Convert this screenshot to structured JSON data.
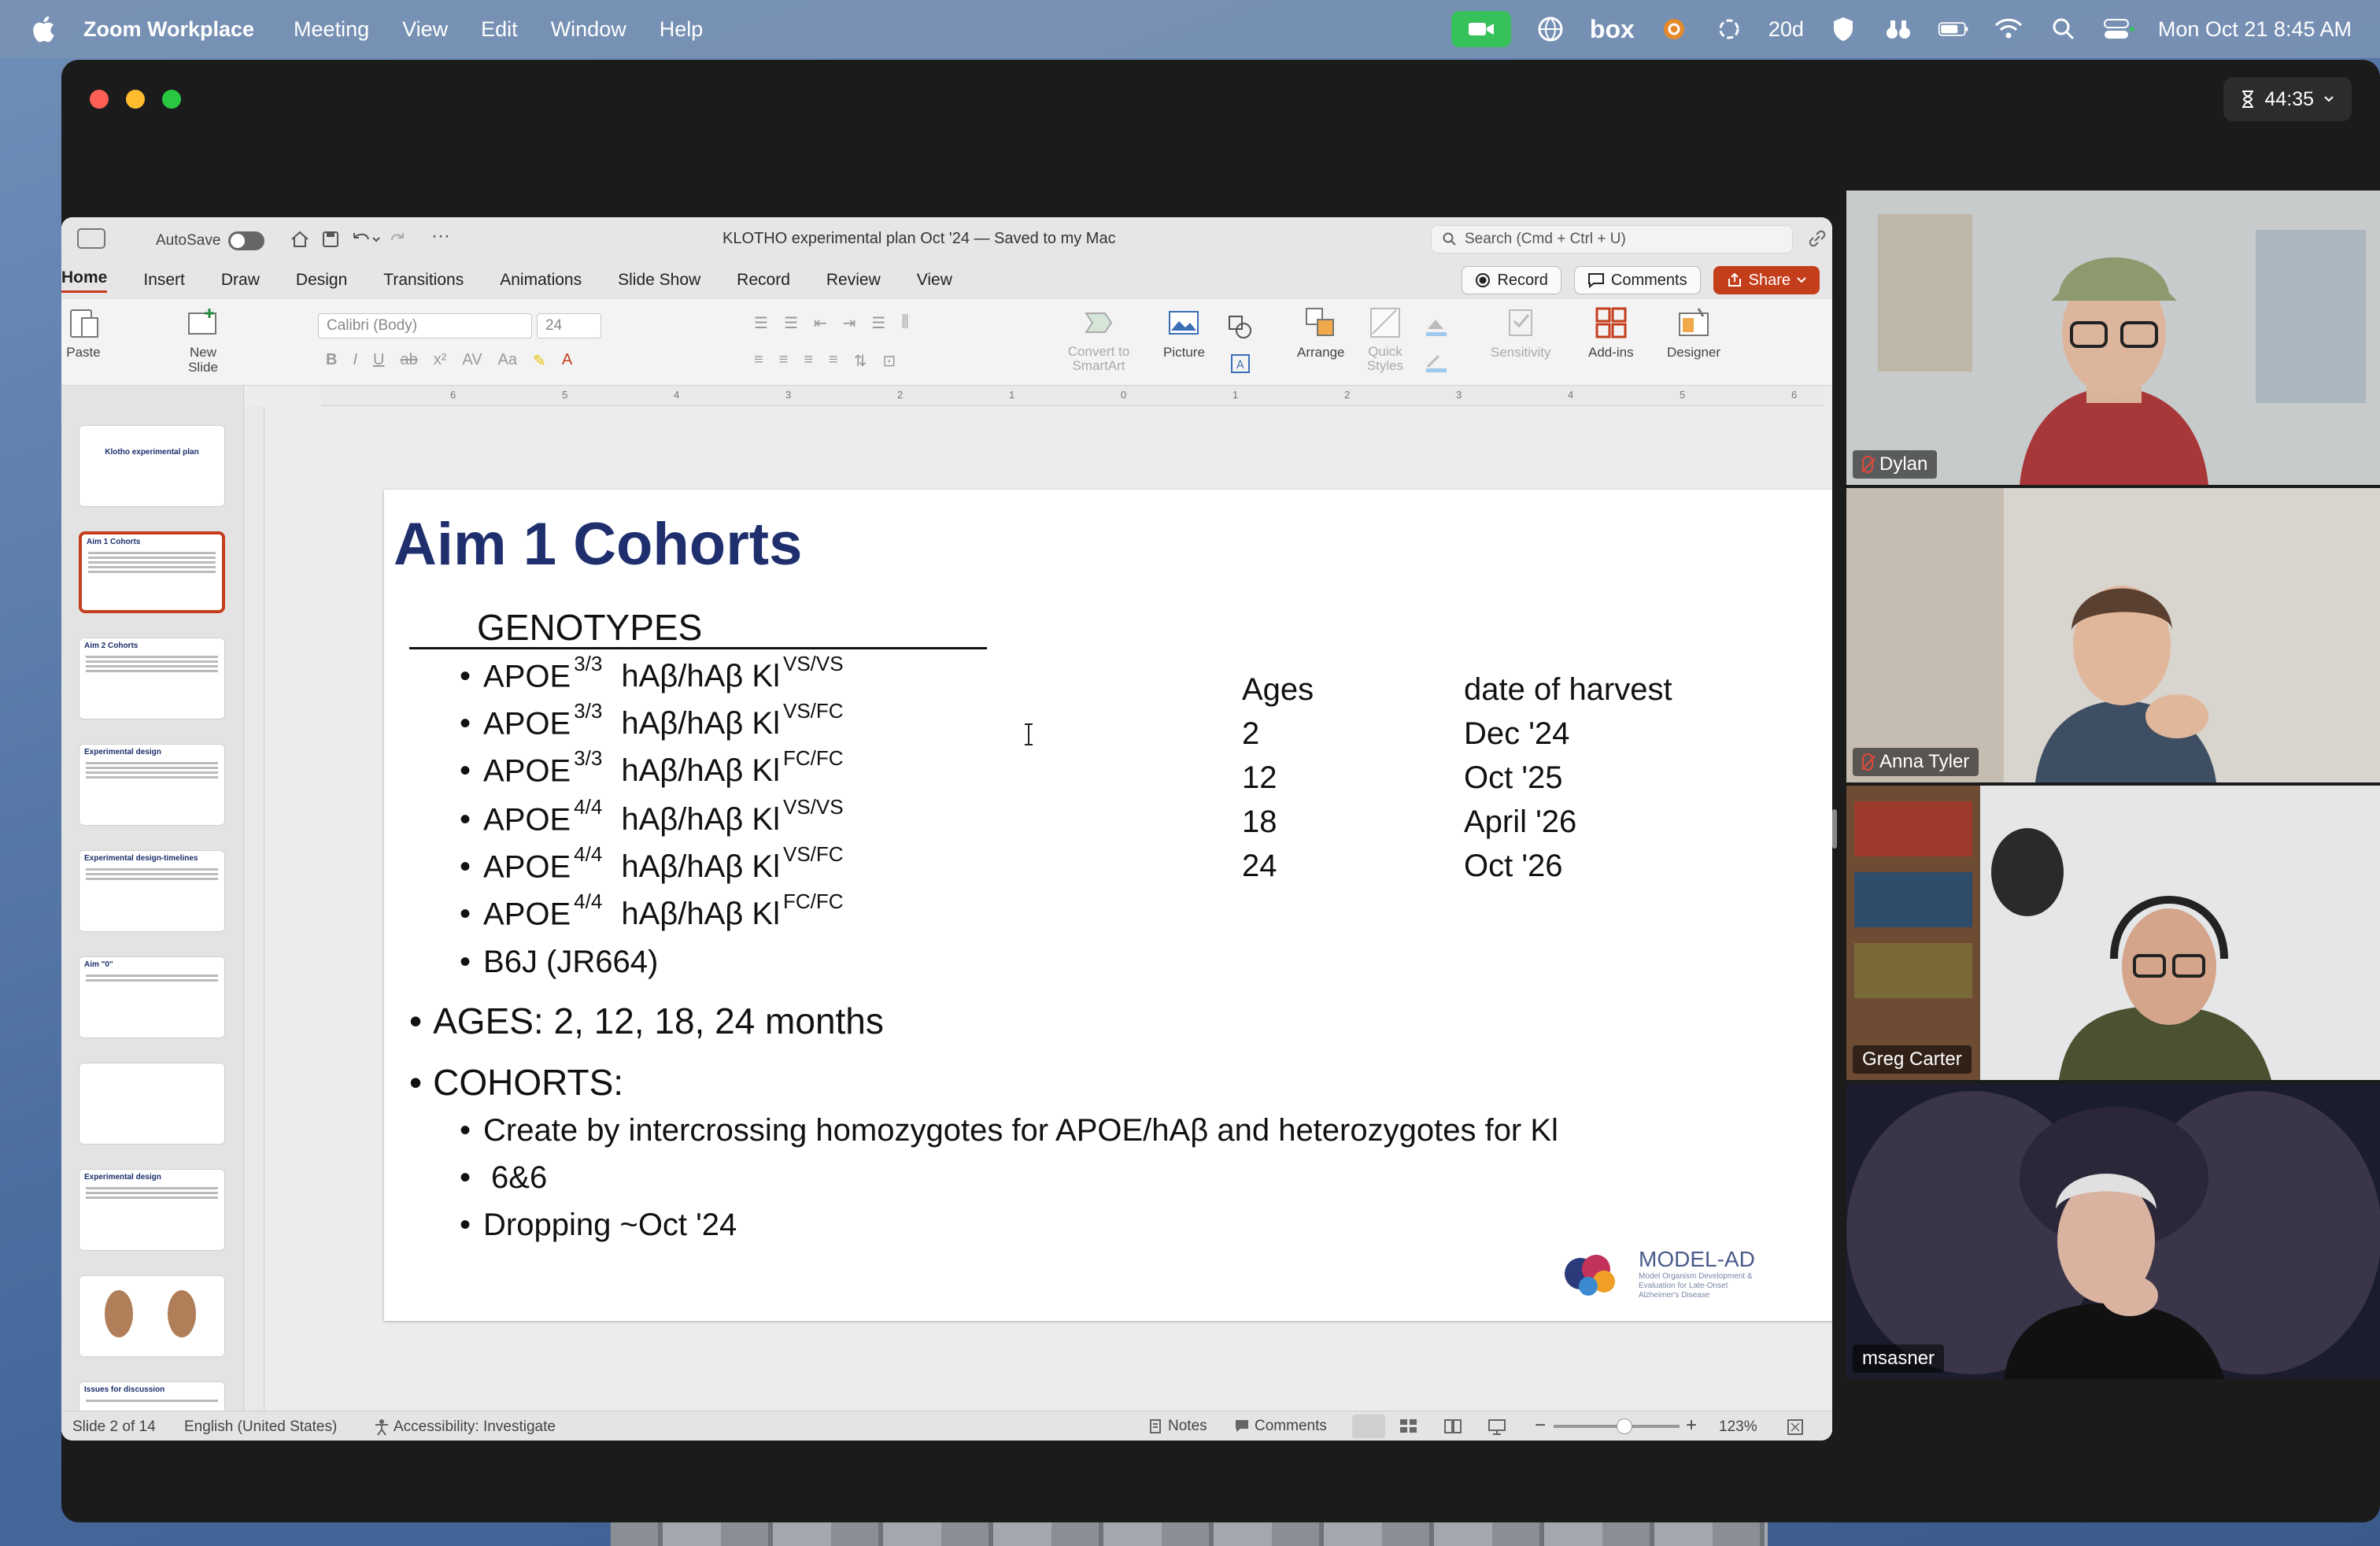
{
  "menubar": {
    "app_name": "Zoom Workplace",
    "items": [
      "Meeting",
      "View",
      "Edit",
      "Window",
      "Help"
    ],
    "box_label": "box",
    "count_label": "20d",
    "clock": "Mon Oct 21  8:45 AM"
  },
  "zoom": {
    "timer": "44:35"
  },
  "powerpoint": {
    "autosave_label": "AutoSave",
    "doc_title": "KLOTHO experimental plan Oct '24 — Saved to my Mac",
    "search_placeholder": "Search (Cmd + Ctrl + U)",
    "tabs": [
      "Home",
      "Insert",
      "Draw",
      "Design",
      "Transitions",
      "Animations",
      "Slide Show",
      "Record",
      "Review",
      "View"
    ],
    "record_button": "Record",
    "comments_button": "Comments",
    "share_button": "Share",
    "ribbon": {
      "paste": "Paste",
      "new_slide": "New Slide",
      "font_name": "Calibri (Body)",
      "font_size": "24",
      "convert": "Convert to SmartArt",
      "picture": "Picture",
      "arrange": "Arrange",
      "quick_styles": "Quick Styles",
      "sensitivity": "Sensitivity",
      "addins": "Add-ins",
      "designer": "Designer"
    },
    "ruler_marks": [
      "6",
      "5",
      "4",
      "3",
      "2",
      "1",
      "0",
      "1",
      "2",
      "3",
      "4",
      "5",
      "6"
    ],
    "thumbnails": [
      {
        "title": "Klotho experimental plan"
      },
      {
        "title": "Aim 1 Cohorts"
      },
      {
        "title": "Aim 2 Cohorts"
      },
      {
        "title": "Experimental design"
      },
      {
        "title": "Experimental design-timelines"
      },
      {
        "title": "Aim \"0\""
      },
      {
        "title": ""
      },
      {
        "title": "Experimental design"
      },
      {
        "title": ""
      },
      {
        "title": "Issues for discussion"
      }
    ],
    "statusbar": {
      "slide": "Slide 2 of 14",
      "language": "English (United States)",
      "accessibility": "Accessibility: Investigate",
      "notes": "Notes",
      "comments": "Comments",
      "zoom": "123%"
    }
  },
  "slide": {
    "title": "Aim 1 Cohorts",
    "genotypes_heading": "GENOTYPES",
    "genotypes": [
      {
        "apoe": "APOE",
        "apoe_sup": "3/3",
        "gene": "hAβ/hAβ Kl",
        "gene_sup": "VS/VS"
      },
      {
        "apoe": "APOE",
        "apoe_sup": "3/3",
        "gene": "hAβ/hAβ Kl",
        "gene_sup": "VS/FC"
      },
      {
        "apoe": "APOE",
        "apoe_sup": "3/3",
        "gene": "hAβ/hAβ Kl",
        "gene_sup": "FC/FC"
      },
      {
        "apoe": "APOE",
        "apoe_sup": "4/4",
        "gene": "hAβ/hAβ Kl",
        "gene_sup": "VS/VS"
      },
      {
        "apoe": "APOE",
        "apoe_sup": "4/4",
        "gene": "hAβ/hAβ Kl",
        "gene_sup": "VS/FC"
      },
      {
        "apoe": "APOE",
        "apoe_sup": "4/4",
        "gene": "hAβ/hAβ Kl",
        "gene_sup": "FC/FC"
      }
    ],
    "b6j": "B6J (JR664)",
    "ages_line": "AGES: 2, 12, 18, 24 months",
    "cohorts_heading": "COHORTS:",
    "cohort_items": [
      "Create by intercrossing homozygotes for APOE/hAβ and heterozygotes for Kl",
      "6&6",
      "Dropping ~Oct '24"
    ],
    "table": {
      "col_ages": "Ages",
      "col_harvest": "date of harvest",
      "rows": [
        {
          "age": "2",
          "harvest": "Dec '24"
        },
        {
          "age": "12",
          "harvest": "Oct '25"
        },
        {
          "age": "18",
          "harvest": "April '26"
        },
        {
          "age": "24",
          "harvest": "Oct '26"
        }
      ]
    },
    "logo_name": "MODEL-AD",
    "logo_sub": "Model Organism Development & Evaluation for Late-Onset Alzheimer's Disease",
    "page_number": "2"
  },
  "participants": [
    {
      "name": "Dylan",
      "muted": true
    },
    {
      "name": "Anna Tyler",
      "muted": true
    },
    {
      "name": "Greg Carter",
      "muted": false
    },
    {
      "name": "msasner",
      "muted": false
    }
  ]
}
